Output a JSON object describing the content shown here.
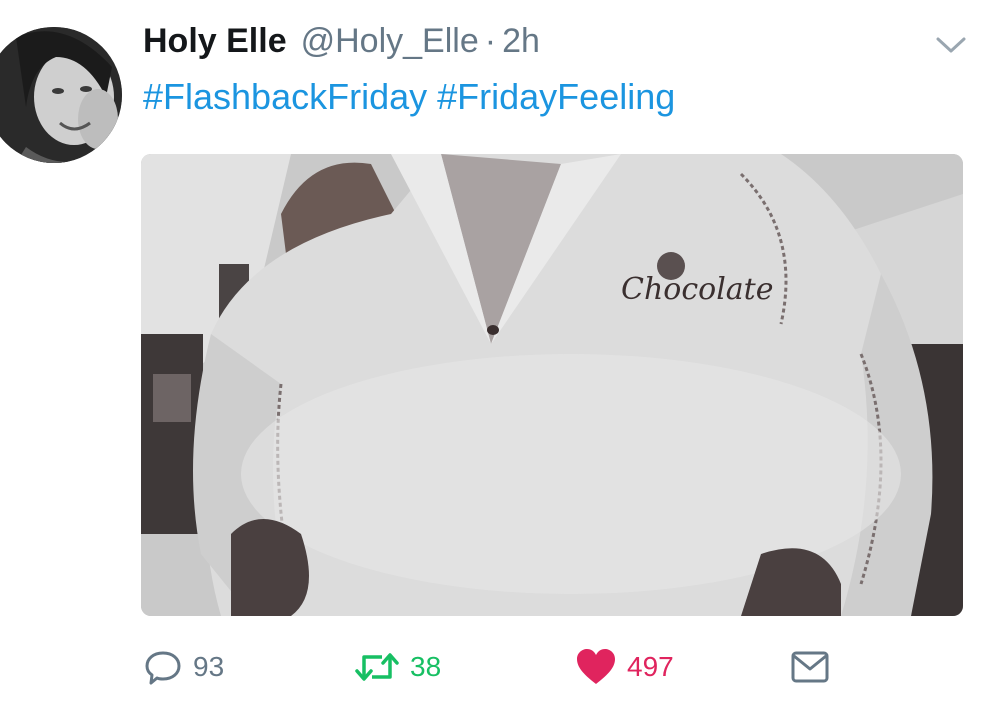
{
  "tweet": {
    "author_name": "Holy Elle",
    "author_handle": "@Holy_Elle",
    "separator": "·",
    "time": "2h",
    "hashtags": [
      "#FlashbackFriday",
      "#FridayFeeling"
    ]
  },
  "actions": {
    "reply_count": "93",
    "retweet_count": "38",
    "like_count": "497"
  },
  "colors": {
    "hashtag": "#1b95e0",
    "retweet": "#17bf63",
    "like": "#e0245e",
    "muted": "#657786"
  },
  "media": {
    "logo_text": "Chocolate"
  }
}
